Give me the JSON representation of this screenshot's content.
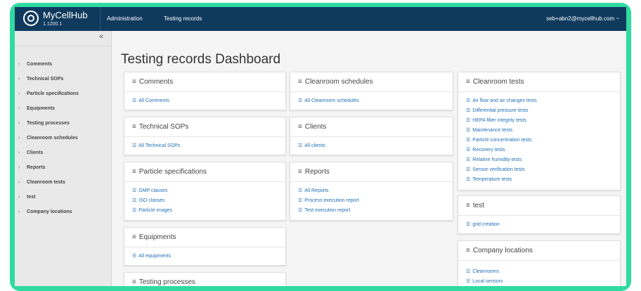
{
  "header": {
    "brand_name": "MyCellHub",
    "version": "1.1200.1",
    "nav": [
      "Administration",
      "Testing records"
    ],
    "user": "seb+abn2@mycellhub.com ~"
  },
  "sidebar": {
    "collapse_glyph": "«",
    "items": [
      {
        "label": "Comments"
      },
      {
        "label": "Technical SOPs"
      },
      {
        "label": "Particle specifications"
      },
      {
        "label": "Equipments"
      },
      {
        "label": "Testing processes"
      },
      {
        "label": "Cleanroom schedules"
      },
      {
        "label": "Clients"
      },
      {
        "label": "Reports"
      },
      {
        "label": "Cleanroom tests"
      },
      {
        "label": "test"
      },
      {
        "label": "Company locations"
      }
    ]
  },
  "main": {
    "title": "Testing records Dashboard",
    "cards": [
      {
        "title": "Comments",
        "links": [
          "All Comments"
        ]
      },
      {
        "title": "Technical SOPs",
        "links": [
          "All Technical SOPs"
        ]
      },
      {
        "title": "Particle specifications",
        "links": [
          "GMP classes",
          "ISO classes",
          "Particle images"
        ]
      },
      {
        "title": "Equipments",
        "links": [
          "All equipments"
        ]
      },
      {
        "title": "Testing processes",
        "links": []
      },
      {
        "title": "Cleanroom schedules",
        "links": [
          "All Cleanroom schedules"
        ]
      },
      {
        "title": "Clients",
        "links": [
          "All clients"
        ]
      },
      {
        "title": "Reports",
        "links": [
          "All Reports",
          "Process execution report",
          "Test execution report"
        ]
      },
      {
        "title": "Cleanroom tests",
        "links": [
          "Air flow and air changes tests",
          "Differential pressure tests",
          "HEPA filter integrity tests",
          "Maintenance tests",
          "Particle concentration tests",
          "Recovery tests",
          "Relative humidity tests",
          "Sensor verification tests",
          "Temperature tests"
        ]
      },
      {
        "title": "test",
        "links": [
          "grid creation"
        ]
      },
      {
        "title": "Company locations",
        "links": [
          "Cleanrooms",
          "Local sensors"
        ]
      }
    ]
  },
  "icons": {
    "chevron": "›",
    "menu": "≡",
    "link": "☰"
  },
  "colors": {
    "header_bg": "#0f3a5e",
    "frame": "#2fdba0",
    "link": "#1f6fb5",
    "sidebar_bg": "#e9e9e9"
  }
}
